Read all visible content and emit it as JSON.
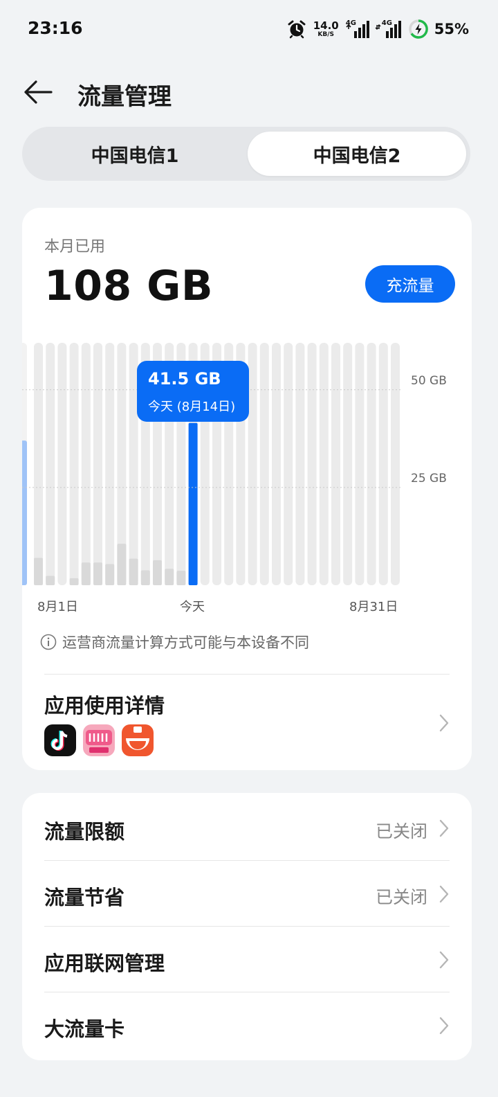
{
  "status_bar": {
    "time": "23:16",
    "net_speed_value": "14.0",
    "net_speed_unit": "KB/S",
    "sig1_tag": "4G",
    "sig2_tag": "4G",
    "battery_percent": "55%"
  },
  "header": {
    "title": "流量管理"
  },
  "sim_tabs": [
    {
      "label": "中国电信1",
      "selected": false
    },
    {
      "label": "中国电信2",
      "selected": true
    }
  ],
  "usage": {
    "label": "本月已用",
    "value": "108 GB",
    "topup_button": "充流量"
  },
  "chart_data": {
    "type": "bar",
    "x_start_label": "8月1日",
    "x_today_label": "今天",
    "x_end_label": "8月31日",
    "y_tick_labels": [
      "50 GB",
      "25 GB"
    ],
    "y_ticks": [
      50,
      25
    ],
    "ylim": [
      0,
      62
    ],
    "previous_month_bar": 37,
    "days": [
      1,
      2,
      3,
      4,
      5,
      6,
      7,
      8,
      9,
      10,
      11,
      12,
      13,
      14,
      15,
      16,
      17,
      18,
      19,
      20,
      21,
      22,
      23,
      24,
      25,
      26,
      27,
      28,
      29,
      30,
      31
    ],
    "values": [
      7,
      2.4,
      0,
      1.8,
      5.8,
      5.8,
      5.4,
      10.6,
      6.8,
      3.8,
      6.4,
      4.2,
      3.7,
      41.5,
      null,
      null,
      null,
      null,
      null,
      null,
      null,
      null,
      null,
      null,
      null,
      null,
      null,
      null,
      null,
      null,
      null
    ],
    "today_index": 13,
    "tooltip_value": "41.5 GB",
    "tooltip_date": "今天 (8月14日)",
    "colors": {
      "track": "#ebebeb",
      "past": "#d9d9d9",
      "today": "#0a6cf5",
      "previous": "#9fc3f7"
    }
  },
  "note": "运营商流量计算方式可能与本设备不同",
  "app_detail": {
    "title": "应用使用详情",
    "apps": [
      "tiktok-icon",
      "bilibili-icon",
      "fanqie-icon"
    ]
  },
  "settings": [
    {
      "label": "流量限额",
      "value": "已关闭"
    },
    {
      "label": "流量节省",
      "value": "已关闭"
    },
    {
      "label": "应用联网管理",
      "value": ""
    },
    {
      "label": "大流量卡",
      "value": ""
    }
  ]
}
